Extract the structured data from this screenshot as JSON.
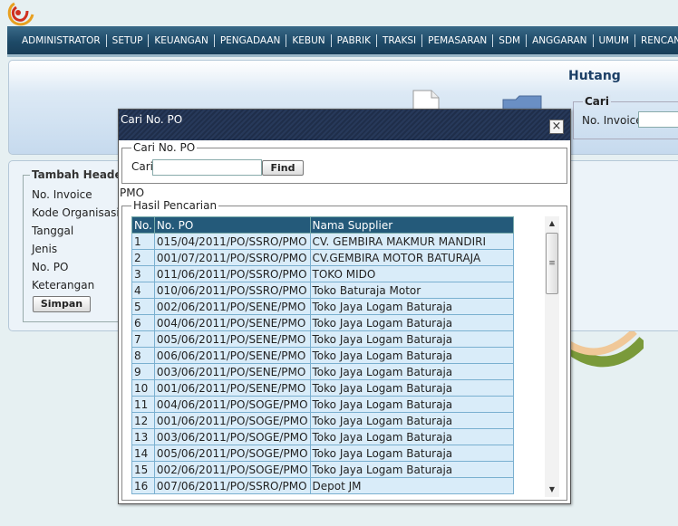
{
  "nav": {
    "items": [
      "ADMINISTRATOR",
      "SETUP",
      "KEUANGAN",
      "PENGADAAN",
      "KEBUN",
      "PABRIK",
      "TRAKSI",
      "PEMASARAN",
      "SDM",
      "ANGGARAN",
      "UMUM",
      "RENCANA"
    ]
  },
  "page": {
    "title": "Hutang",
    "search": {
      "legend": "Cari",
      "invoice_label": "No. Invoice",
      "invoice_value": ""
    }
  },
  "form": {
    "legend": "Tambah Header",
    "fields": [
      "No. Invoice",
      "Kode Organisasi",
      "Tanggal",
      "Jenis",
      "No. PO",
      "Keterangan"
    ],
    "save_label": "Simpan"
  },
  "dialog": {
    "title": "Cari No. PO",
    "close_label": "×",
    "search_legend": "Cari No. PO",
    "cari_label": "Cari",
    "cari_value": "",
    "find_label": "Find",
    "pmo_label": "PMO",
    "results_legend": "Hasil Pencarian",
    "columns": [
      "No.",
      "No. PO",
      "Nama Supplier"
    ],
    "rows": [
      [
        "1",
        "015/04/2011/PO/SSRO/PMO",
        "CV. GEMBIRA MAKMUR MANDIRI"
      ],
      [
        "2",
        "001/07/2011/PO/SSRO/PMO",
        "CV.GEMBIRA MOTOR BATURAJA"
      ],
      [
        "3",
        "011/06/2011/PO/SSRO/PMO",
        "TOKO MIDO"
      ],
      [
        "4",
        "010/06/2011/PO/SSRO/PMO",
        "Toko Baturaja Motor"
      ],
      [
        "5",
        "002/06/2011/PO/SENE/PMO",
        "Toko Jaya Logam Baturaja"
      ],
      [
        "6",
        "004/06/2011/PO/SENE/PMO",
        "Toko Jaya Logam Baturaja"
      ],
      [
        "7",
        "005/06/2011/PO/SENE/PMO",
        "Toko Jaya Logam Baturaja"
      ],
      [
        "8",
        "006/06/2011/PO/SENE/PMO",
        "Toko Jaya Logam Baturaja"
      ],
      [
        "9",
        "003/06/2011/PO/SENE/PMO",
        "Toko Jaya Logam Baturaja"
      ],
      [
        "10",
        "001/06/2011/PO/SENE/PMO",
        "Toko Jaya Logam Baturaja"
      ],
      [
        "11",
        "004/06/2011/PO/SOGE/PMO",
        "Toko Jaya Logam Baturaja"
      ],
      [
        "12",
        "001/06/2011/PO/SOGE/PMO",
        "Toko Jaya Logam Baturaja"
      ],
      [
        "13",
        "003/06/2011/PO/SOGE/PMO",
        "Toko Jaya Logam Baturaja"
      ],
      [
        "14",
        "005/06/2011/PO/SOGE/PMO",
        "Toko Jaya Logam Baturaja"
      ],
      [
        "15",
        "002/06/2011/PO/SOGE/PMO",
        "Toko Jaya Logam Baturaja"
      ],
      [
        "16",
        "007/06/2011/PO/SSRO/PMO",
        "Depot JM"
      ]
    ]
  }
}
